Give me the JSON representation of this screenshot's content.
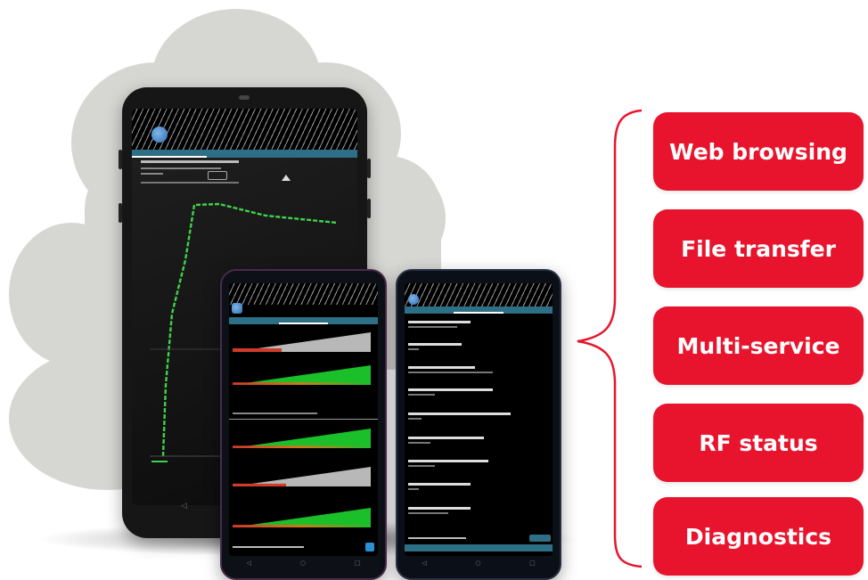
{
  "features": [
    {
      "label": "Web browsing"
    },
    {
      "label": "File transfer"
    },
    {
      "label": "Multi-service"
    },
    {
      "label": "RF status"
    },
    {
      "label": "Diagnostics"
    }
  ],
  "icons": {
    "cloud": "cloud-icon",
    "brace": "curly-brace-icon",
    "avatar": "app-logo-icon",
    "chart": "throughput-chart-icon",
    "nav_back": "back-arrow-icon",
    "nav_home": "home-icon",
    "nav_recents": "recents-icon"
  },
  "colors": {
    "accent": "#e8142d",
    "cloud": "#d6d6d3",
    "tab_bar": "#2c6f86",
    "chart_line": "#3fd24a",
    "gauge_red": "#d23a2a",
    "gauge_green": "#1bbf2a",
    "gauge_grey": "#b8b8b8"
  },
  "nav": {
    "back": "◁",
    "home": "○",
    "recents": "□"
  }
}
